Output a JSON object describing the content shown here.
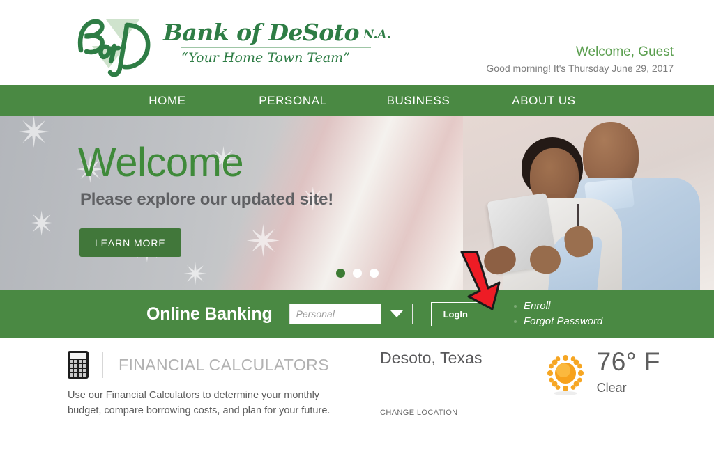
{
  "header": {
    "logo": {
      "monogram": "BofD",
      "bank_name": "Bank of DeSoto",
      "suffix": "N.A.",
      "tagline": "“Your Home Town Team”"
    },
    "welcome_user": "Welcome, Guest",
    "welcome_date": "Good morning! It's Thursday June 29, 2017"
  },
  "nav": {
    "items": [
      {
        "label": "HOME"
      },
      {
        "label": "PERSONAL"
      },
      {
        "label": "BUSINESS"
      },
      {
        "label": "ABOUT US"
      }
    ]
  },
  "hero": {
    "title": "Welcome",
    "subtitle": "Please explore our updated site!",
    "cta_label": "LEARN MORE",
    "slides": [
      {
        "active": true
      },
      {
        "active": false
      },
      {
        "active": false
      }
    ]
  },
  "online_banking": {
    "label": "Online Banking",
    "account_type_value": "Personal",
    "account_type_placeholder": "Personal",
    "login_label": "LogIn",
    "links": [
      {
        "label": "Enroll"
      },
      {
        "label": "Forgot Password"
      }
    ]
  },
  "calculators": {
    "icon": "calculator-icon",
    "title": "FINANCIAL CALCULATORS",
    "description": "Use our Financial Calculators to determine your monthly budget, compare borrowing costs, and plan for your future."
  },
  "weather": {
    "city": "Desoto, Texas",
    "icon": "sun-icon",
    "temperature": "76° F",
    "condition": "Clear",
    "change_location_label": "CHANGE LOCATION"
  },
  "annotation": {
    "arrow": "red-arrow-pointing-to-enroll",
    "color": "#ee1c25"
  },
  "colors": {
    "brand_green": "#4a8943",
    "hero_green": "#3f8a3a",
    "welcome_green": "#5a9e4e",
    "text_gray": "#58595b",
    "sun_orange": "#f5a623"
  }
}
